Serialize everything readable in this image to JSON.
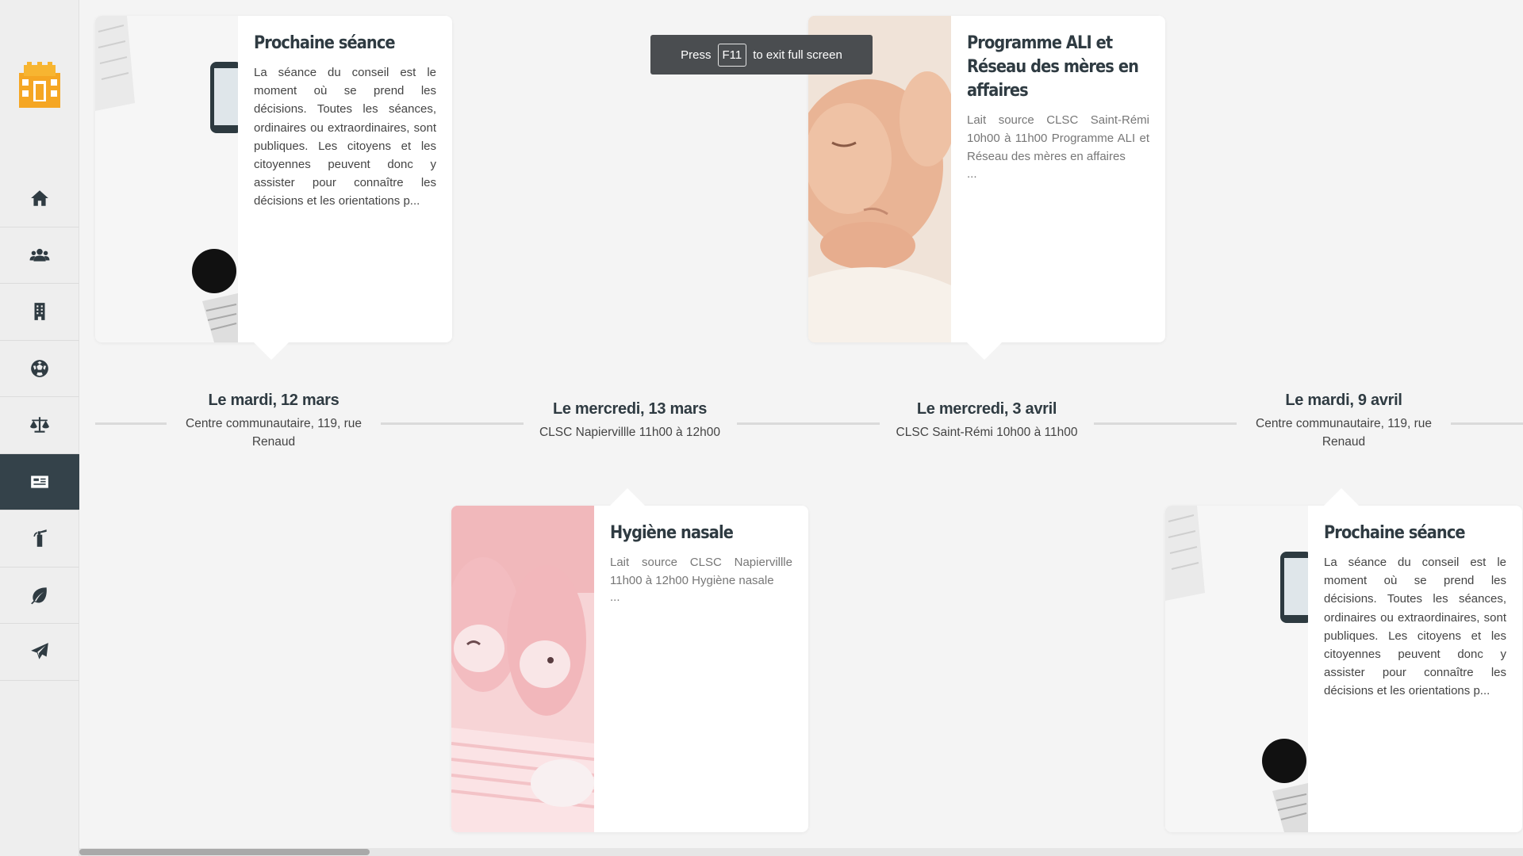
{
  "sidebar": {
    "items": [
      {
        "icon": "home-icon",
        "active": false
      },
      {
        "icon": "users-icon",
        "active": false
      },
      {
        "icon": "building-icon",
        "active": false
      },
      {
        "icon": "soccer-ball-icon",
        "active": false
      },
      {
        "icon": "scales-icon",
        "active": false
      },
      {
        "icon": "newspaper-icon",
        "active": true
      },
      {
        "icon": "fire-extinguisher-icon",
        "active": false
      },
      {
        "icon": "leaf-icon",
        "active": false
      },
      {
        "icon": "paper-plane-icon",
        "active": false
      }
    ],
    "active_color": "#34424a"
  },
  "toast": {
    "press": "Press",
    "key": "F11",
    "rest": "to exit full screen"
  },
  "timeline": {
    "stops": [
      {
        "date": "Le mardi, 12 mars",
        "location": "Centre communautaire, 119, rue Renaud"
      },
      {
        "date": "Le mercredi, 13 mars",
        "location": "CLSC Napiervillle 11h00 à 12h00"
      },
      {
        "date": "Le mercredi, 3 avril",
        "location": "CLSC Saint-Rémi 10h00 à 11h00"
      },
      {
        "date": "Le mardi, 9 avril",
        "location": "Centre communautaire, 119, rue Renaud"
      }
    ],
    "cards": [
      {
        "title": "Prochaine séance",
        "text": "La séance du conseil est le moment où se prend les décisions. Toutes les séances, ordinaires ou extraordinaires, sont publiques. Les citoyens et les citoyennes peuvent donc y assister pour connaître les décisions et les orientations p...",
        "ellipsis": ""
      },
      {
        "title": "Hygiène nasale",
        "text": "Lait source CLSC Napiervillle 11h00 à 12h00 Hygiène nasale",
        "ellipsis": "..."
      },
      {
        "title": "Programme ALI et Réseau des mères en affaires",
        "text": "Lait source CLSC Saint-Rémi 10h00 à 11h00 Programme ALI et Réseau des mères en affaires",
        "ellipsis": "..."
      },
      {
        "title": "Prochaine séance",
        "text": "La séance du conseil est le moment où se prend les décisions. Toutes les séances, ordinaires ou extraordinaires, sont publiques. Les citoyens et les citoyennes peuvent donc y assister pour connaître les décisions et les orientations p...",
        "ellipsis": ""
      }
    ]
  },
  "scrollbar": {
    "position": 0.0
  }
}
